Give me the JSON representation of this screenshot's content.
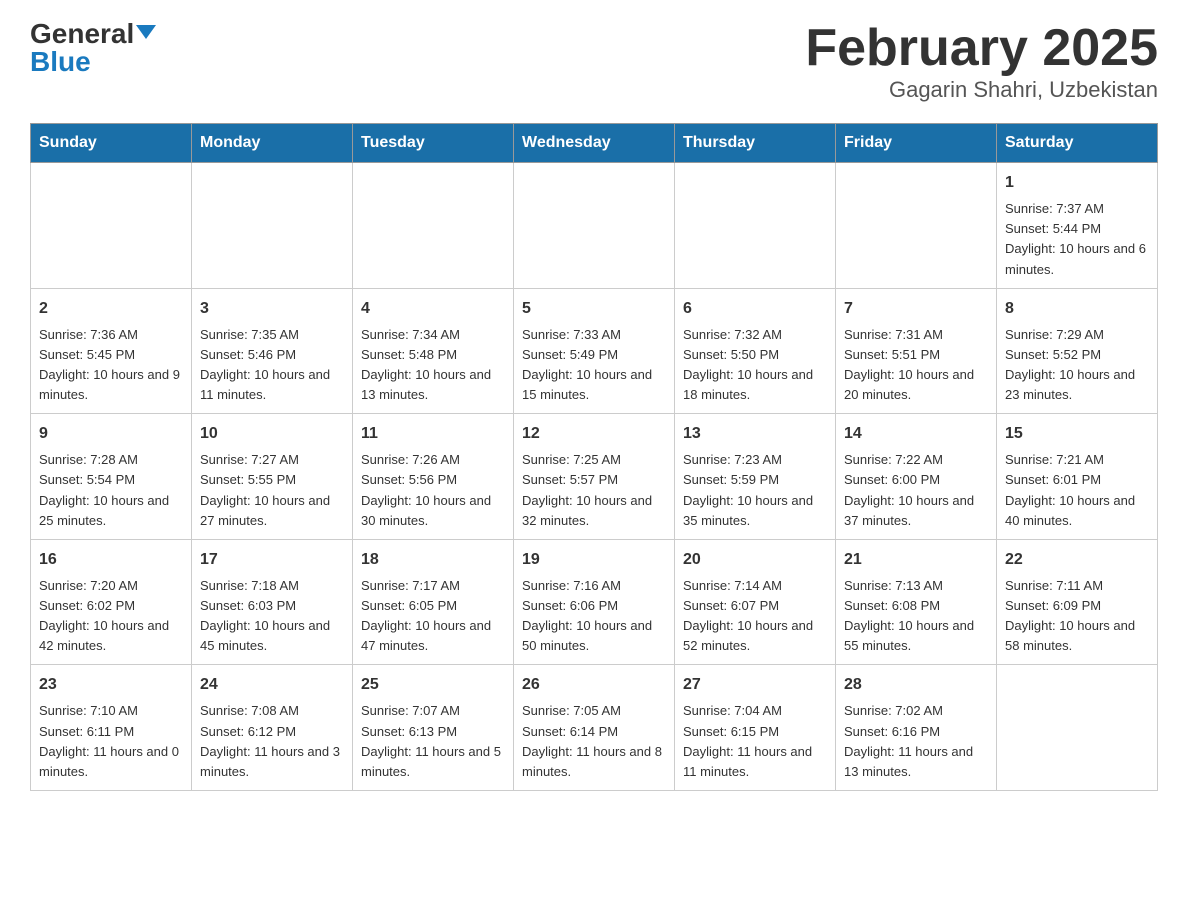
{
  "header": {
    "logo_general": "General",
    "logo_blue": "Blue",
    "title": "February 2025",
    "subtitle": "Gagarin Shahri, Uzbekistan"
  },
  "days_of_week": [
    "Sunday",
    "Monday",
    "Tuesday",
    "Wednesday",
    "Thursday",
    "Friday",
    "Saturday"
  ],
  "weeks": [
    [
      {
        "day": "",
        "info": ""
      },
      {
        "day": "",
        "info": ""
      },
      {
        "day": "",
        "info": ""
      },
      {
        "day": "",
        "info": ""
      },
      {
        "day": "",
        "info": ""
      },
      {
        "day": "",
        "info": ""
      },
      {
        "day": "1",
        "info": "Sunrise: 7:37 AM\nSunset: 5:44 PM\nDaylight: 10 hours and 6 minutes."
      }
    ],
    [
      {
        "day": "2",
        "info": "Sunrise: 7:36 AM\nSunset: 5:45 PM\nDaylight: 10 hours and 9 minutes."
      },
      {
        "day": "3",
        "info": "Sunrise: 7:35 AM\nSunset: 5:46 PM\nDaylight: 10 hours and 11 minutes."
      },
      {
        "day": "4",
        "info": "Sunrise: 7:34 AM\nSunset: 5:48 PM\nDaylight: 10 hours and 13 minutes."
      },
      {
        "day": "5",
        "info": "Sunrise: 7:33 AM\nSunset: 5:49 PM\nDaylight: 10 hours and 15 minutes."
      },
      {
        "day": "6",
        "info": "Sunrise: 7:32 AM\nSunset: 5:50 PM\nDaylight: 10 hours and 18 minutes."
      },
      {
        "day": "7",
        "info": "Sunrise: 7:31 AM\nSunset: 5:51 PM\nDaylight: 10 hours and 20 minutes."
      },
      {
        "day": "8",
        "info": "Sunrise: 7:29 AM\nSunset: 5:52 PM\nDaylight: 10 hours and 23 minutes."
      }
    ],
    [
      {
        "day": "9",
        "info": "Sunrise: 7:28 AM\nSunset: 5:54 PM\nDaylight: 10 hours and 25 minutes."
      },
      {
        "day": "10",
        "info": "Sunrise: 7:27 AM\nSunset: 5:55 PM\nDaylight: 10 hours and 27 minutes."
      },
      {
        "day": "11",
        "info": "Sunrise: 7:26 AM\nSunset: 5:56 PM\nDaylight: 10 hours and 30 minutes."
      },
      {
        "day": "12",
        "info": "Sunrise: 7:25 AM\nSunset: 5:57 PM\nDaylight: 10 hours and 32 minutes."
      },
      {
        "day": "13",
        "info": "Sunrise: 7:23 AM\nSunset: 5:59 PM\nDaylight: 10 hours and 35 minutes."
      },
      {
        "day": "14",
        "info": "Sunrise: 7:22 AM\nSunset: 6:00 PM\nDaylight: 10 hours and 37 minutes."
      },
      {
        "day": "15",
        "info": "Sunrise: 7:21 AM\nSunset: 6:01 PM\nDaylight: 10 hours and 40 minutes."
      }
    ],
    [
      {
        "day": "16",
        "info": "Sunrise: 7:20 AM\nSunset: 6:02 PM\nDaylight: 10 hours and 42 minutes."
      },
      {
        "day": "17",
        "info": "Sunrise: 7:18 AM\nSunset: 6:03 PM\nDaylight: 10 hours and 45 minutes."
      },
      {
        "day": "18",
        "info": "Sunrise: 7:17 AM\nSunset: 6:05 PM\nDaylight: 10 hours and 47 minutes."
      },
      {
        "day": "19",
        "info": "Sunrise: 7:16 AM\nSunset: 6:06 PM\nDaylight: 10 hours and 50 minutes."
      },
      {
        "day": "20",
        "info": "Sunrise: 7:14 AM\nSunset: 6:07 PM\nDaylight: 10 hours and 52 minutes."
      },
      {
        "day": "21",
        "info": "Sunrise: 7:13 AM\nSunset: 6:08 PM\nDaylight: 10 hours and 55 minutes."
      },
      {
        "day": "22",
        "info": "Sunrise: 7:11 AM\nSunset: 6:09 PM\nDaylight: 10 hours and 58 minutes."
      }
    ],
    [
      {
        "day": "23",
        "info": "Sunrise: 7:10 AM\nSunset: 6:11 PM\nDaylight: 11 hours and 0 minutes."
      },
      {
        "day": "24",
        "info": "Sunrise: 7:08 AM\nSunset: 6:12 PM\nDaylight: 11 hours and 3 minutes."
      },
      {
        "day": "25",
        "info": "Sunrise: 7:07 AM\nSunset: 6:13 PM\nDaylight: 11 hours and 5 minutes."
      },
      {
        "day": "26",
        "info": "Sunrise: 7:05 AM\nSunset: 6:14 PM\nDaylight: 11 hours and 8 minutes."
      },
      {
        "day": "27",
        "info": "Sunrise: 7:04 AM\nSunset: 6:15 PM\nDaylight: 11 hours and 11 minutes."
      },
      {
        "day": "28",
        "info": "Sunrise: 7:02 AM\nSunset: 6:16 PM\nDaylight: 11 hours and 13 minutes."
      },
      {
        "day": "",
        "info": ""
      }
    ]
  ]
}
